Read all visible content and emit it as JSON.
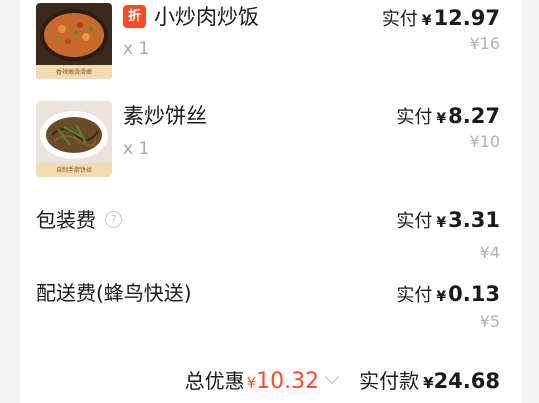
{
  "items": [
    {
      "name": "小炒肉炒饭",
      "discount_badge": "折",
      "qty": "x 1",
      "paid_label": "实付",
      "currency": "¥",
      "paid_amount": "12.97",
      "original_price": "¥16",
      "thumb_caption": "香辣嫩滑滑嫩"
    },
    {
      "name": "素炒饼丝",
      "qty": "x 1",
      "paid_label": "实付",
      "currency": "¥",
      "paid_amount": "8.27",
      "original_price": "¥10",
      "thumb_caption": "自制手擀饼丝"
    }
  ],
  "fees": [
    {
      "name": "包装费",
      "paid_label": "实付",
      "currency": "¥",
      "paid_amount": "3.31",
      "original_price": "¥4",
      "has_info_icon": true
    },
    {
      "name": "配送费(蜂鸟快送)",
      "paid_label": "实付",
      "currency": "¥",
      "paid_amount": "0.13",
      "original_price": "¥5"
    }
  ],
  "totals": {
    "discount_label": "总优惠",
    "discount_currency": "¥",
    "discount_amount": "10.32",
    "paid_label": "实付款",
    "paid_currency": "¥",
    "paid_amount": "24.68"
  },
  "colors": {
    "accent_red": "#ff4a2a",
    "muted": "#b3b3b3",
    "page_bg": "#f3f3f3",
    "card_bg": "#ffffff"
  },
  "icons": {
    "info": "info-circle-icon",
    "chevron": "chevron-down-icon"
  }
}
